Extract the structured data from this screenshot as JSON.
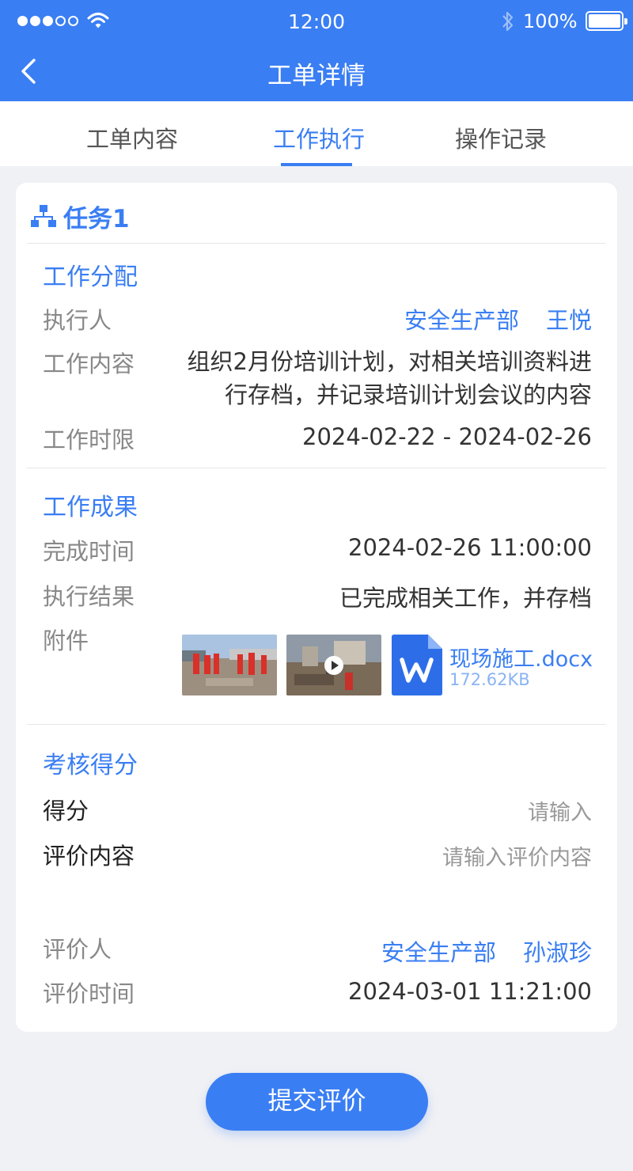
{
  "status_bar": {
    "time": "12:00",
    "battery": "100%"
  },
  "nav": {
    "title": "工单详情"
  },
  "tabs": [
    {
      "label": "工单内容"
    },
    {
      "label": "工作执行"
    },
    {
      "label": "操作记录"
    }
  ],
  "task": {
    "title": "任务1",
    "assignment": {
      "section_title": "工作分配",
      "executor_label": "执行人",
      "executor_dept": "安全生产部",
      "executor_name": "王悦",
      "content_label": "工作内容",
      "content_value": "组织2月份培训计划，对相关培训资料进行存档，并记录培训计划会议的内容",
      "deadline_label": "工作时限",
      "deadline_value": "2024-02-22 - 2024-02-26"
    },
    "result": {
      "section_title": "工作成果",
      "finish_label": "完成时间",
      "finish_value": "2024-02-26 11:00:00",
      "outcome_label": "执行结果",
      "outcome_value": "已完成相关工作，并存档",
      "attachment_label": "附件",
      "file_name": "现场施工.docx",
      "file_size": "172.62KB"
    },
    "evaluation": {
      "section_title": "考核得分",
      "score_label": "得分",
      "score_placeholder": "请输入",
      "comment_label": "评价内容",
      "comment_placeholder": "请输入评价内容",
      "evaluator_label": "评价人",
      "evaluator_dept": "安全生产部",
      "evaluator_name": "孙淑珍",
      "eval_time_label": "评价时间",
      "eval_time_value": "2024-03-01 11:21:00"
    }
  },
  "submit_label": "提交评价",
  "colors": {
    "primary": "#3a7ef3",
    "background": "#f0f1f5"
  }
}
